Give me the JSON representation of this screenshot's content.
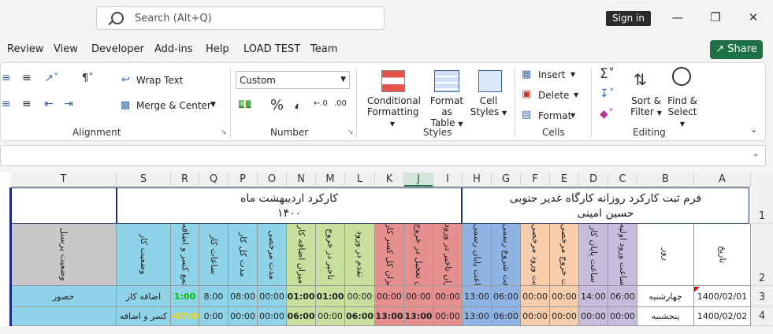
{
  "titlebar": {
    "search_placeholder": "Search (Alt+Q)",
    "signin": "Sign in"
  },
  "menu": [
    "Review",
    "View",
    "Developer",
    "Add-ins",
    "Help",
    "LOAD TEST",
    "Team"
  ],
  "share": "Share",
  "ribbon": {
    "alignment": {
      "wrap_text": "Wrap Text",
      "merge_center": "Merge & Center",
      "label": "Alignment"
    },
    "number": {
      "format": "Custom",
      "label": "Number"
    },
    "styles": {
      "conditional": [
        "Conditional",
        "Formatting"
      ],
      "format_table": [
        "Format as",
        "Table"
      ],
      "cell_styles": [
        "Cell",
        "Styles"
      ],
      "label": "Styles"
    },
    "cells": {
      "insert": "Insert",
      "delete": "Delete",
      "format": "Format",
      "label": "Cells"
    },
    "editing": {
      "sort_filter": [
        "Sort &",
        "Filter"
      ],
      "find_select": [
        "Find &",
        "Select"
      ],
      "label": "Editing"
    }
  },
  "sheet": {
    "columns": [
      "T",
      "S",
      "R",
      "Q",
      "P",
      "O",
      "N",
      "M",
      "L",
      "K",
      "J",
      "I",
      "H",
      "G",
      "F",
      "E",
      "D",
      "C",
      "B",
      "A"
    ],
    "selected_column": "J",
    "rows": [
      "1",
      "2",
      "3",
      "4"
    ],
    "title_right": [
      "فرم ثبت کارکرد روزانه کارگاه غدیر جنوبی",
      "حسین امینی"
    ],
    "title_left": [
      "کارکرد اردیبهشت ماه",
      "۱۴۰۰"
    ],
    "headers": {
      "T": "وضعیت پرسنل",
      "S": "وضعیت کار",
      "R": "جمع کسر و اضافه",
      "Q": "ساعات کار",
      "P": "مدت کل کار",
      "O": "مدت مرخصی",
      "N": "میزان اضافه کار",
      "M": "تاخیر در خروج",
      "L": "تقدم در ورود",
      "K": "میزان کل کسر کار",
      "J": "میزان تعجیل در خروج",
      "I": "میزان تاخیر در ورود",
      "H": "ساعت پایان رسمی",
      "G": "ساعت شروع رسمی",
      "F": "ساعت ورود مرخصی",
      "E": "ساعت خروج مرخصی",
      "D": "ساعت پایان کار",
      "C": "ساعت ورود اولیه",
      "B": "روز",
      "A": "تاریخ"
    },
    "row3": {
      "T": "حضور",
      "S": "اضافه کار",
      "R": "1:00",
      "Q": "8:00",
      "P": "08:00",
      "O": "00:00",
      "N": "01:00",
      "M": "01:00",
      "L": "00:00",
      "K": "00:00",
      "J": "00:00",
      "I": "00:00",
      "H": "13:00",
      "G": "06:00",
      "F": "00:00",
      "E": "00:00",
      "D": "14:00",
      "C": "06:00",
      "B": "چهارشنبه",
      "A": "1400/02/01"
    },
    "row4": {
      "T": "",
      "S": "کسر و اضافه",
      "R": "-07:00",
      "Q": "0:00",
      "P": "00:00",
      "O": "00:00",
      "N": "06:00",
      "M": "00:00",
      "L": "06:00",
      "K": "13:00",
      "J": "13:00",
      "I": "00:00",
      "H": "13:00",
      "G": "06:00",
      "F": "00:00",
      "E": "00:00",
      "D": "00:00",
      "C": "00:00",
      "B": "پنجشنبه",
      "A": "1400/02/02"
    }
  },
  "colors": {
    "accent_green": "#1e7145",
    "green_value": "#00c000",
    "yellow_value": "#ffd800"
  }
}
